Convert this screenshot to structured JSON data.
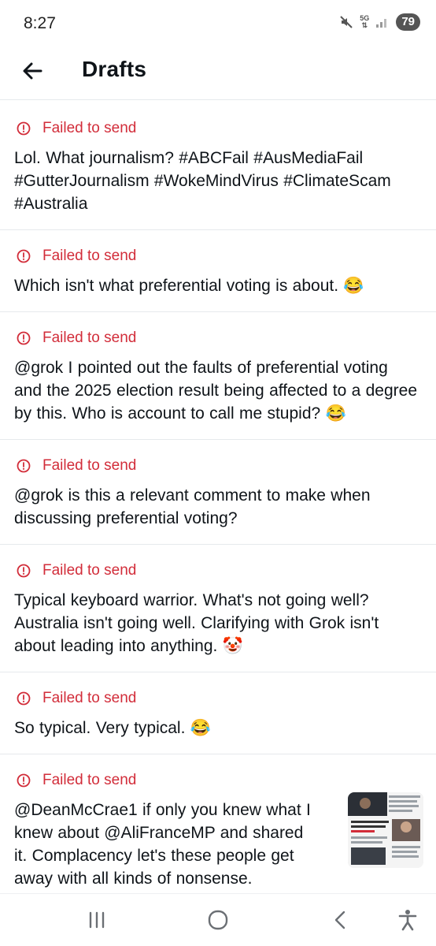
{
  "status_bar": {
    "time": "8:27",
    "network": "5G",
    "battery": "79"
  },
  "header": {
    "title": "Drafts"
  },
  "failed_label": "Failed to send",
  "drafts": [
    {
      "status": "Failed to send",
      "text": "Lol. What journalism? #ABCFail #AusMediaFail #GutterJournalism #WokeMindVirus #ClimateScam #Australia"
    },
    {
      "status": "Failed to send",
      "text": "Which isn't what preferential voting is about. 😂"
    },
    {
      "status": "Failed to send",
      "text": "@grok I pointed out the faults of preferential voting and the 2025 election result being affected to a degree by this. Who is account to call me stupid? 😂"
    },
    {
      "status": "Failed to send",
      "text": "@grok is this a relevant comment to make when discussing preferential voting?"
    },
    {
      "status": "Failed to send",
      "text": "Typical keyboard warrior. What's not going well? Australia isn't going well. Clarifying with Grok isn't about leading into anything. 🤡"
    },
    {
      "status": "Failed to send",
      "text": "So typical. Very typical. 😂"
    },
    {
      "status": "Failed to send",
      "text": "@DeanMcCrae1 if only you knew what I knew about @AliFranceMP and shared it. Complacency let's these people get away with all kinds of nonsense."
    }
  ],
  "icons": {
    "back": "arrow-left-icon",
    "failed": "alert-circle-icon",
    "recents": "recent-apps-icon",
    "home": "home-icon",
    "nav_back": "chevron-left-icon",
    "accessibility": "accessibility-icon"
  },
  "colors": {
    "error": "#d22d3a",
    "text": "#0f1419",
    "divider": "#e6e9ec"
  }
}
